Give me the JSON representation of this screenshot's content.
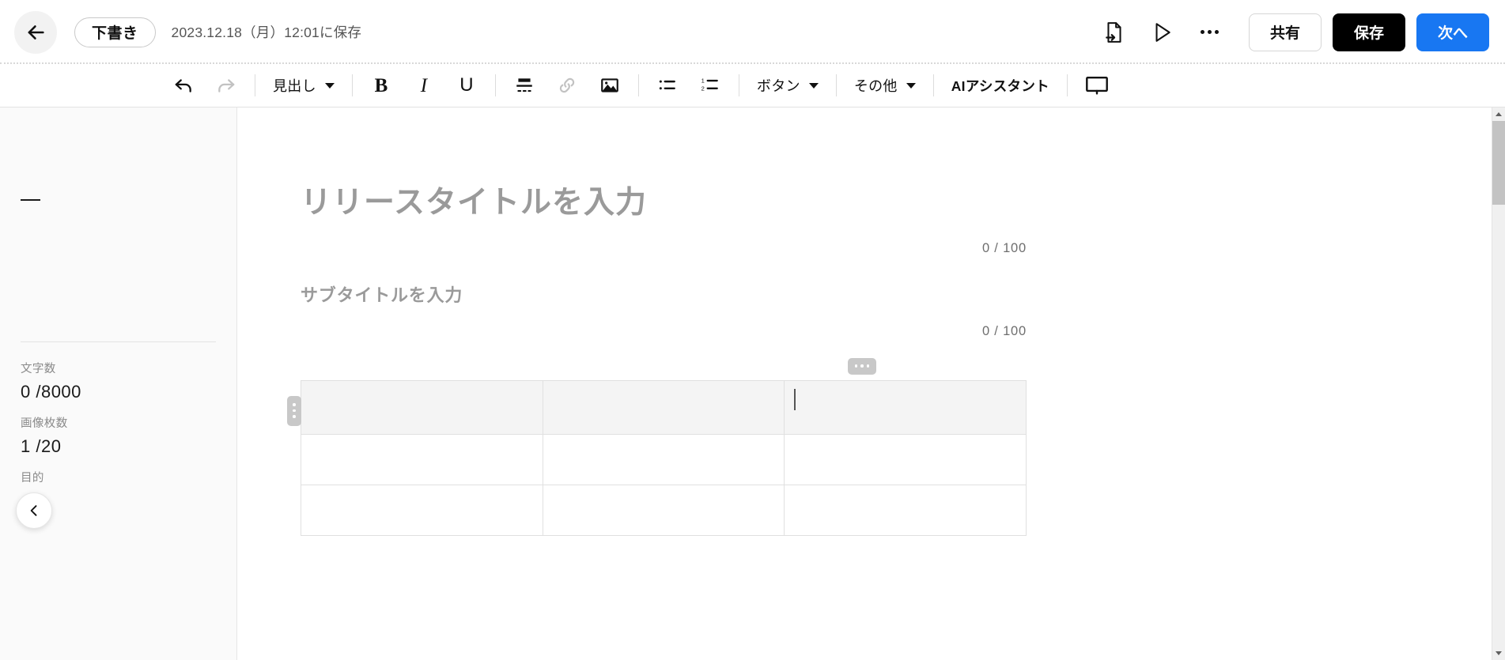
{
  "header": {
    "back_icon": "arrow-left-icon",
    "status_chip": "下書き",
    "saved_text": "2023.12.18（月）12:01に保存",
    "export_icon": "file-export-icon",
    "preview_icon": "play-triangle-icon",
    "more_icon": "ellipsis-horizontal-icon",
    "share_label": "共有",
    "save_label": "保存",
    "next_label": "次へ",
    "save_bg": "#000000",
    "next_bg": "#1877f2"
  },
  "toolbar": {
    "undo_icon": "undo-arrow-icon",
    "redo_icon": "redo-arrow-icon",
    "heading_label": "見出し",
    "bold_label": "B",
    "italic_label": "I",
    "underline_label": "U",
    "divider_icon": "horizontal-rule-icon",
    "link_icon": "link-chain-icon",
    "image_icon": "image-picture-icon",
    "bullet_list_icon": "bulleted-list-icon",
    "numbered_list_icon": "numbered-list-icon",
    "button_label": "ボタン",
    "other_label": "その他",
    "ai_assistant_label": "AIアシスタント",
    "preview_display_icon": "monitor-display-icon"
  },
  "sidebar": {
    "dash_marker": "—",
    "stats": [
      {
        "label": "文字数",
        "value": "0 /8000"
      },
      {
        "label": "画像枚数",
        "value": "1 /20"
      },
      {
        "label": "目的",
        "value": ""
      }
    ],
    "collapse_icon": "chevron-left-icon"
  },
  "editor": {
    "title_placeholder": "リリースタイトルを入力",
    "title_counter": "0 / 100",
    "subtitle_placeholder": "サブタイトルを入力",
    "subtitle_counter": "0 / 100",
    "table": {
      "row_handle_icon": "row-menu-dots-icon",
      "col_handle_icon": "column-menu-dots-icon",
      "rows": [
        {
          "header": true,
          "cells": [
            "",
            "",
            ""
          ]
        },
        {
          "header": false,
          "cells": [
            "",
            "",
            ""
          ]
        },
        {
          "header": false,
          "cells": [
            "",
            "",
            ""
          ]
        }
      ]
    }
  },
  "scrollbar": {
    "up_icon": "scroll-up-arrow-icon",
    "down_icon": "scroll-down-arrow-icon"
  }
}
